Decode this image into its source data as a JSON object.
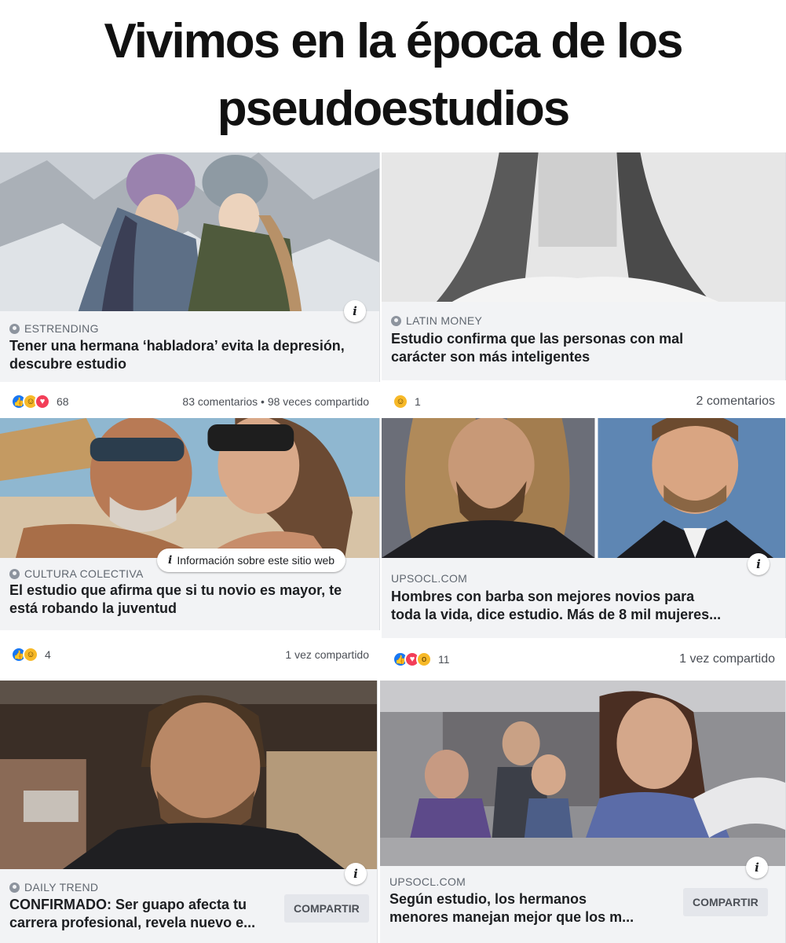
{
  "meme": {
    "line1": "Vivimos en la época de los",
    "line2": "pseudoestudios"
  },
  "posts": [
    {
      "source": "ESTRENDING",
      "headline_line1": "Tener una hermana ‘habladora’ evita la depresión,",
      "headline_line2": "descubre estudio",
      "reactions": [
        "like",
        "haha",
        "love"
      ],
      "reaction_count": "68",
      "stats_right": "83 comentarios • 98 veces compartido",
      "image": "two-women-in-winter-hats"
    },
    {
      "source": "LATIN MONEY",
      "headline_line1": "Estudio confirma que las personas con mal",
      "headline_line2": "carácter son más inteligentes",
      "reactions": [
        "haha"
      ],
      "reaction_count": "1",
      "stats_right": "2 comentarios",
      "image": "woman-neck-black-and-white"
    },
    {
      "source": "CULTURA COLECTIVA",
      "headline_line1": "El estudio que afirma que si tu novio es mayor, te",
      "headline_line2": "está robando la juventud",
      "site_info_label": "Información sobre este sitio web",
      "reactions": [
        "like",
        "haha"
      ],
      "reaction_count": "4",
      "stats_right": "1 vez compartido",
      "image": "older-man-and-young-woman-sunglasses"
    },
    {
      "source": "UPSOCL.COM",
      "headline_line1": "Hombres con barba son mejores novios para",
      "headline_line2": "toda la vida, dice estudio. Más de 8 mil mujeres...",
      "reactions": [
        "like",
        "love",
        "wow"
      ],
      "reaction_count": "11",
      "stats_right": "1 vez compartido",
      "image": "two-bearded-men"
    },
    {
      "source": "DAILY TREND",
      "headline_line1": "CONFIRMADO: Ser guapo afecta tu",
      "headline_line2": "carrera profesional, revela nuevo e...",
      "share_label": "COMPARTIR",
      "image": "crying-man"
    },
    {
      "source": "UPSOCL.COM",
      "headline_line1": "Según estudio, los hermanos",
      "headline_line2": "menores manejan mejor que los m...",
      "share_label": "COMPARTIR",
      "image": "girl-driving-car-with-family"
    }
  ],
  "icons": {
    "info": "i",
    "globe": "globe-icon"
  },
  "colors": {
    "card_bg": "#f2f3f5",
    "like": "#1877f2",
    "love": "#f33e58",
    "haha": "#f7b928"
  }
}
